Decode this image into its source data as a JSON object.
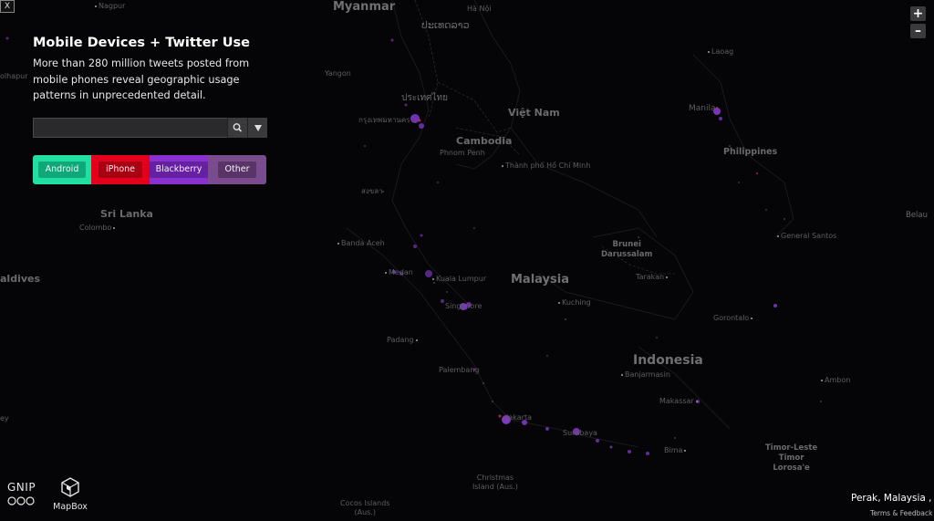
{
  "panel": {
    "title": "Mobile Devices + Twitter Use",
    "description": "More than 280 million tweets posted from mobile phones reveal geographic usage patterns in unprecedented detail.",
    "search_value": "",
    "search_icon": "search-icon",
    "locate_icon": "locate-arrow-icon"
  },
  "legend": {
    "android": {
      "label": "Android",
      "color": "#1fe0a0"
    },
    "iphone": {
      "label": "iPhone",
      "color": "#e4001a"
    },
    "blackberry": {
      "label": "Blackberry",
      "color": "#8a2fd0"
    },
    "other": {
      "label": "Other",
      "color": "#7a4c8e"
    }
  },
  "controls": {
    "close": "X",
    "zoom_in": "+",
    "zoom_out": "–"
  },
  "map": {
    "countries": {
      "myanmar": "Myanmar",
      "viet_nam": "Việt Nam",
      "cambodia": "Cambodia",
      "sri_lanka": "Sri Lanka",
      "maldives": "aldives",
      "malaysia": "Malaysia",
      "indonesia": "Indonesia",
      "philippines": "Philippines",
      "brunei": "Brunei\nDarussalam",
      "timor_leste": "Timor-Leste\nTimor\nLorosa'e",
      "belau": "Belau"
    },
    "places": {
      "nagpur": "Nagpur",
      "ha_noi": "Hà Nội",
      "lao": "ປະເທດລາວ",
      "yangon": "Yangon",
      "thai": "ประเทศไทย",
      "bangkok": "กรุงเทพมหานคร",
      "phnom_penh": "Phnom Penh",
      "hcmc": "Thành phố Hồ Chí Minh",
      "laoag": "Laoag",
      "manila": "Manila",
      "colombo": "Colombo",
      "banda_aceh": "Banda Aceh",
      "medan": "Medan",
      "kuala_lumpur": "Kuala Lumpur",
      "singapore": "Singapore",
      "padang": "Padang",
      "palembang": "Palembang",
      "jakarta": "Jakarta",
      "surabaya": "Surabaya",
      "kuching": "Kuching",
      "tarakan": "Tarakan",
      "gorontalo": "Gorontalo",
      "banjarmasin": "Banjarmasin",
      "makassar": "Makassar",
      "bima": "Bima",
      "ambon": "Ambon",
      "general_santos": "General Santos",
      "christmas": "Christmas\nIsland (Aus.)",
      "cocos": "Cocos Islands\n(Aus.)",
      "kolhapur": "olhapur",
      "songkhla": "สงขลา",
      "ey": "ey"
    }
  },
  "footer": {
    "gnip": "GNIP",
    "mapbox": "MapBox",
    "location": "Perak, Malaysia  ,",
    "terms": "Terms & Feedback"
  }
}
